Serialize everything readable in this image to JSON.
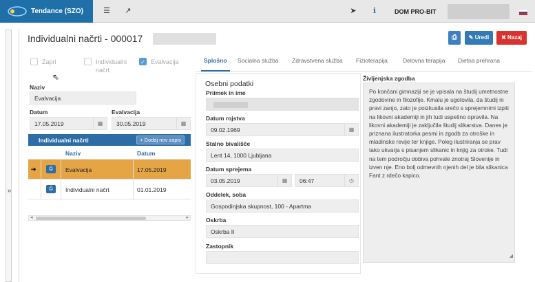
{
  "app": {
    "name": "Tendance (SZO)",
    "org": "DOM PRO-BIT"
  },
  "page": {
    "title": "Individualni načrti - 000017"
  },
  "buttons": {
    "edit": "Uredi",
    "back": "Nazaj"
  },
  "checks": [
    {
      "label": "Zapri",
      "checked": false
    },
    {
      "label": "Individualni načrt",
      "checked": false
    },
    {
      "label": "Evalvacija",
      "checked": true
    }
  ],
  "form": {
    "naziv_label": "Naziv",
    "naziv": "Evalvacija",
    "datum_label": "Datum",
    "datum": "17.05.2019",
    "evalvacija_label": "Evalvacija",
    "evalvacija": "30.05.2019"
  },
  "grid": {
    "title": "Individualni načrti",
    "add": "+ Dodaj nov zapis",
    "cols": [
      "Naziv",
      "Datum"
    ],
    "rows": [
      {
        "naziv": "Evalvacija",
        "datum": "17.05.2019",
        "selected": true
      },
      {
        "naziv": "Individualni načrt",
        "datum": "01.01.2019",
        "selected": false
      }
    ]
  },
  "tabs": [
    "Splošno",
    "Socialna služba",
    "Zdravstvena služba",
    "Fizioterapija",
    "Delovna terapija",
    "Dietna prehrana"
  ],
  "personal": {
    "heading": "Osebni podatki",
    "name_label": "Priimek in ime",
    "dob_label": "Datum rojstva",
    "dob": "09.02.1969",
    "addr_label": "Stalno bivališče",
    "addr": "Lent 14, 1000 Ljubljana",
    "adm_label": "Datum sprejema",
    "adm_date": "03.05.2019",
    "adm_time": "06:47",
    "dept_label": "Oddelek, soba",
    "dept": "Gospodinjska skupnost, 100 - Apartma",
    "care_label": "Oskrba",
    "care": "Oskrba II",
    "rep_label": "Zastopnik",
    "rep": ""
  },
  "life": {
    "label": "Življenjska zgodba",
    "text": "Po končani gimnaziji se je vpisala na študij umetnostne zgodovine in filozofije. Kmalu je ugotovila, da študij ni pravi zanjo, zato je poizkusila srečo s sprejemnimi izpiti na likovni akademiji in jih tudi uspešno opravila. Na likovni akademiji je zaključila študij slikarstva. Danes je priznana ilustratorka pesmi in zgodb za otroške in mladinske revije ter knjige. Poleg ilustriranja se prav tako ukvarja s pisanjem slikanic in knjig za otroke. Tudi na tem področju dobiva pohvale znotraj Slovenije in izven nje. Eno bolj odmevnih njenih del je bila slikanica Fant z rdečo kapico."
  },
  "colors": {
    "brand": "#1f6fa8",
    "selected_row": "#e6a545",
    "back_button": "#d9332f"
  }
}
